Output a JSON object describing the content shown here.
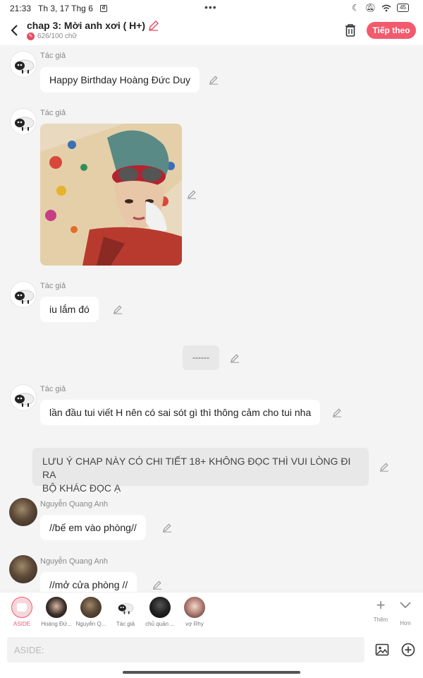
{
  "status": {
    "time": "21:33",
    "date": "Th 3, 17 Thg 6",
    "dots": "•••",
    "battery": "45"
  },
  "header": {
    "title": "chap 3: Mời anh xơi ( H+)",
    "word_count": "626/100 chữ",
    "next_label": "Tiếp theo"
  },
  "messages": [
    {
      "speaker": "Tác giả",
      "text": "Happy Birthday Hoàng Đức Duy"
    },
    {
      "speaker": "Tác giả",
      "image": "photo"
    },
    {
      "speaker": "Tác giả",
      "text": "iu lắm đó"
    },
    {
      "center_text": "------"
    },
    {
      "speaker": "Tác giả",
      "text": "lần đầu tui viết H nên có sai sót gì thì thông cảm cho tui nha"
    },
    {
      "aside_lines": [
        "LƯU Ý CHAP NÀY CÓ CHI TIẾT 18+ KHÔNG ĐỌC THÌ VUI LÒNG ĐI RA",
        "BỘ KHÁC ĐỌC Ạ"
      ]
    },
    {
      "speaker": "Nguyễn Quang Anh",
      "text": "//bế em vào phòng//"
    },
    {
      "speaker": "Nguyễn Quang Anh",
      "text": "//mở cửa phòng //"
    }
  ],
  "characters": [
    "ASIDE",
    "Hoàng Đứ...",
    "Nguyễn Q...",
    "Tác giả",
    "chủ quán ...",
    "vợ Rhy"
  ],
  "tools": {
    "add_label": "Thêm",
    "more_label": "Hơn"
  },
  "input": {
    "placeholder": "ASIDE:"
  }
}
